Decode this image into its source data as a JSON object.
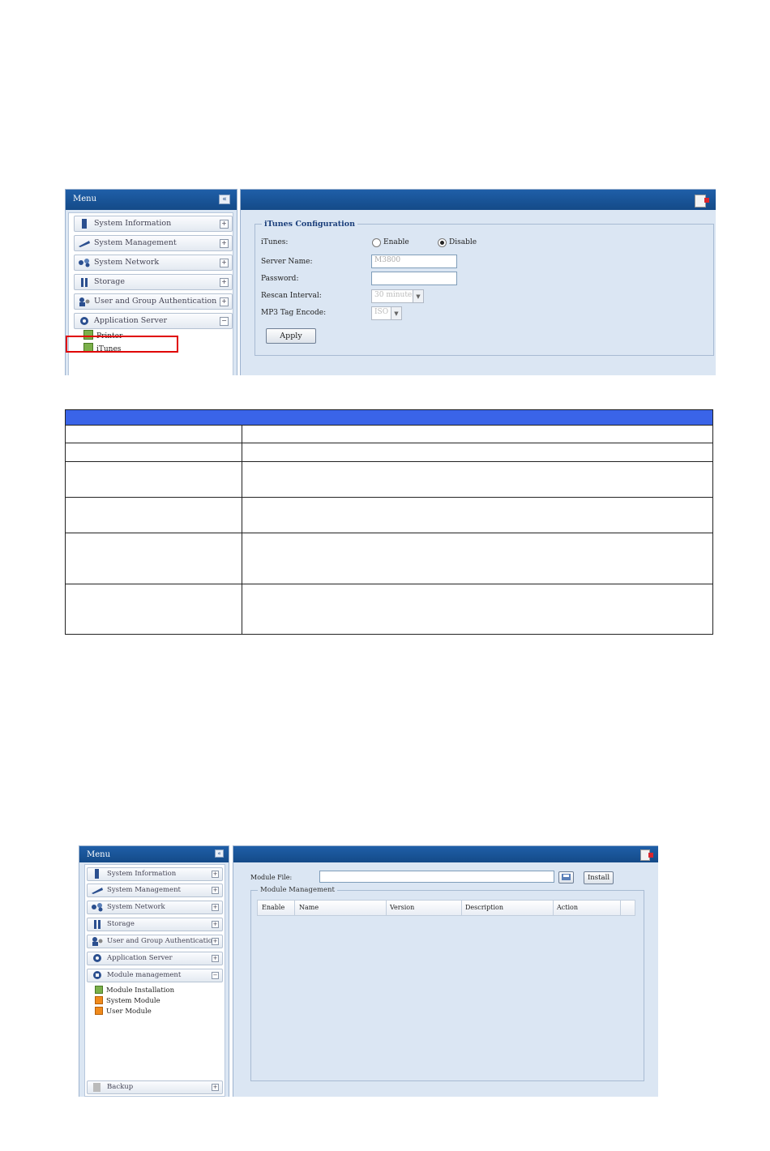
{
  "screen1": {
    "menu": {
      "title": "Menu",
      "collapse_glyph": "«",
      "items": [
        {
          "label": "System Information",
          "icon": "system-information-icon",
          "toggle": "+"
        },
        {
          "label": "System Management",
          "icon": "system-management-icon",
          "toggle": "+"
        },
        {
          "label": "System Network",
          "icon": "system-network-icon",
          "toggle": "+"
        },
        {
          "label": "Storage",
          "icon": "storage-icon",
          "toggle": "+"
        },
        {
          "label": "User and Group Authentication",
          "icon": "user-group-icon",
          "toggle": "+"
        },
        {
          "label": "Application Server",
          "icon": "application-server-icon",
          "toggle": "−"
        }
      ],
      "subitems": [
        {
          "label": "Printer",
          "icon": "cube-icon"
        },
        {
          "label": "iTunes",
          "icon": "cube-icon"
        }
      ]
    },
    "config": {
      "legend": "iTunes Configuration",
      "itunes_label": "iTunes:",
      "enable_label": "Enable",
      "disable_label": "Disable",
      "selected": "Disable",
      "server_name_label": "Server Name:",
      "server_name_value": "M3800",
      "password_label": "Password:",
      "password_value": "",
      "rescan_label": "Rescan Interval:",
      "rescan_value": "30 minutes",
      "mp3_label": "MP3 Tag Encode:",
      "mp3_value": "ISO",
      "apply_label": "Apply"
    }
  },
  "screen2": {
    "menu": {
      "title": "Menu",
      "items": [
        {
          "label": "System Information",
          "toggle": "+"
        },
        {
          "label": "System Management",
          "toggle": "+"
        },
        {
          "label": "System Network",
          "toggle": "+"
        },
        {
          "label": "Storage",
          "toggle": "+"
        },
        {
          "label": "User and Group Authentication",
          "toggle": "+"
        },
        {
          "label": "Application Server",
          "toggle": "+"
        },
        {
          "label": "Module management",
          "toggle": "−"
        }
      ],
      "subitems": [
        {
          "label": "Module Installation"
        },
        {
          "label": "System Module"
        },
        {
          "label": "User Module"
        }
      ],
      "bottom_item": {
        "label": "Backup",
        "toggle": "+"
      }
    },
    "module": {
      "file_label": "Module File:",
      "install_label": "Install",
      "legend": "Module Management",
      "columns": [
        "Enable",
        "Name",
        "Version",
        "Description",
        "Action"
      ]
    }
  },
  "colors": {
    "title_bar": "#1f5fa8",
    "panel_bg": "#dbe6f3",
    "table_header": "#3a64e8",
    "highlight": "#e00000"
  }
}
